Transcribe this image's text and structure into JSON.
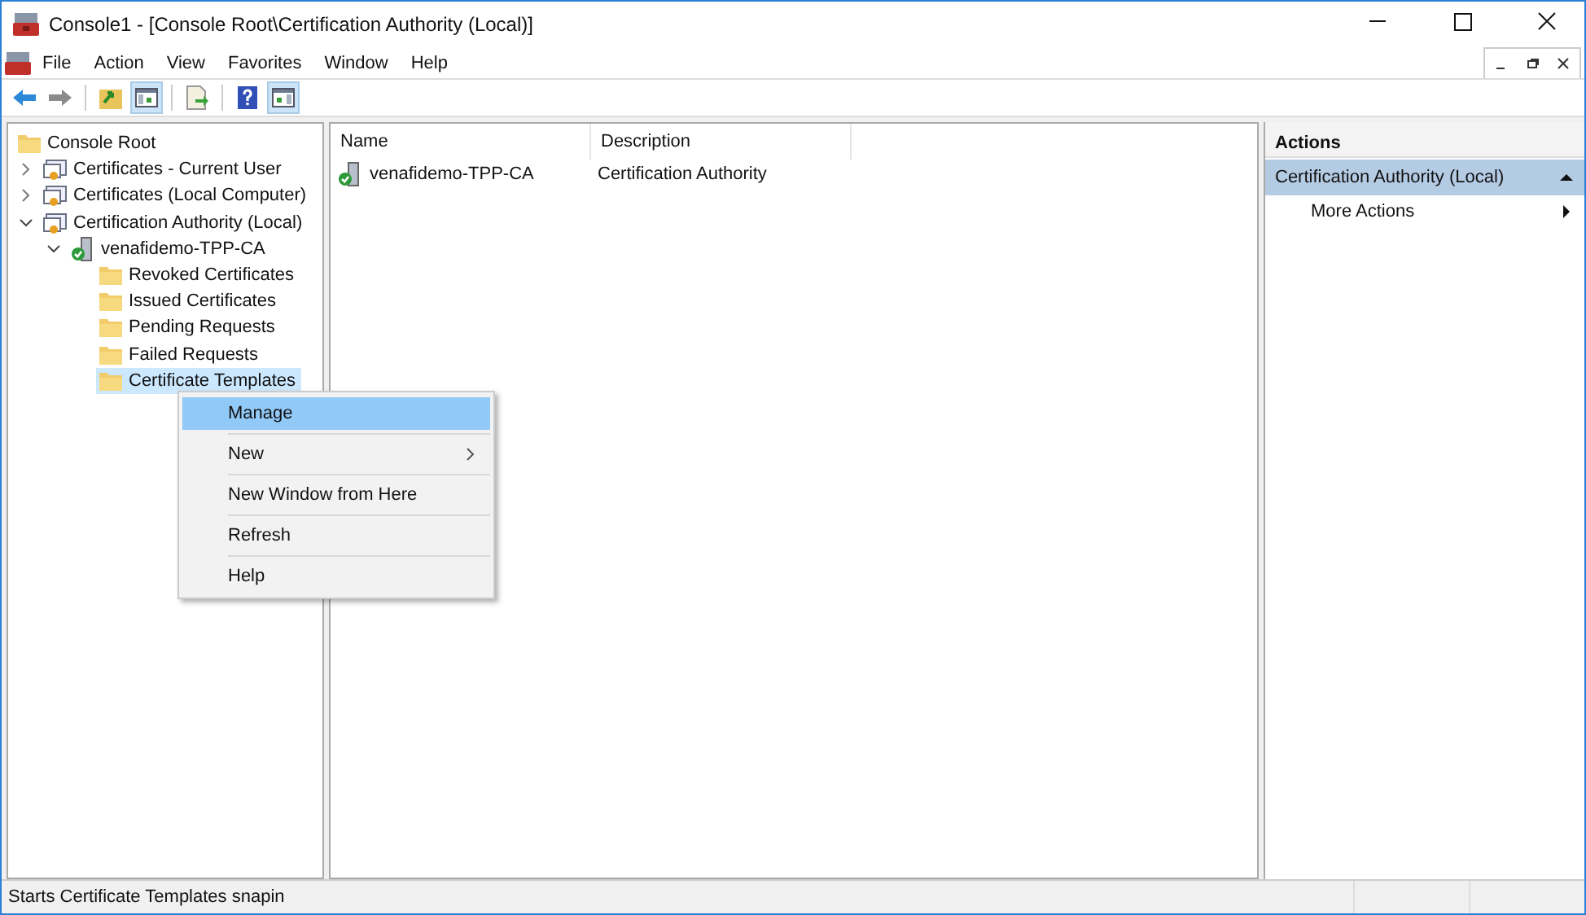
{
  "window": {
    "title": "Console1 - [Console Root\\Certification Authority (Local)]"
  },
  "menu": [
    "File",
    "Action",
    "View",
    "Favorites",
    "Window",
    "Help"
  ],
  "toolbar": [
    {
      "kind": "back",
      "pressed": false
    },
    {
      "kind": "forward",
      "pressed": false
    },
    {
      "kind": "up",
      "pressed": false
    },
    {
      "kind": "tree",
      "pressed": true
    },
    {
      "kind": "export",
      "pressed": false
    },
    {
      "kind": "help",
      "pressed": false
    },
    {
      "kind": "pane",
      "pressed": true
    }
  ],
  "tree": [
    {
      "label": "Console Root",
      "kind": "folder",
      "selected": false,
      "children": [
        {
          "label": "Certificates - Current User",
          "kind": "store",
          "expanded": false,
          "selected": false
        },
        {
          "label": "Certificates (Local Computer)",
          "kind": "store",
          "expanded": false,
          "selected": false
        },
        {
          "label": "Certification Authority (Local)",
          "kind": "store",
          "expanded": true,
          "selected": false,
          "children": [
            {
              "label": "venafidemo-TPP-CA",
              "kind": "server",
              "expanded": true,
              "selected": false,
              "children": [
                {
                  "label": "Revoked Certificates",
                  "kind": "folder",
                  "selected": false
                },
                {
                  "label": "Issued Certificates",
                  "kind": "folder",
                  "selected": false
                },
                {
                  "label": "Pending Requests",
                  "kind": "folder",
                  "selected": false
                },
                {
                  "label": "Failed Requests",
                  "kind": "folder",
                  "selected": false
                },
                {
                  "label": "Certificate Templates",
                  "kind": "folder",
                  "selected": true
                }
              ]
            }
          ]
        }
      ]
    }
  ],
  "list": {
    "columns": [
      "Name",
      "Description"
    ],
    "rows": [
      {
        "name": "venafidemo-TPP-CA",
        "description": "Certification Authority"
      }
    ]
  },
  "context_menu": [
    {
      "label": "Manage",
      "selected": true,
      "submenu": false
    },
    {
      "label": "New",
      "selected": false,
      "submenu": true
    },
    {
      "label": "New Window from Here",
      "selected": false,
      "submenu": false
    },
    {
      "label": "Refresh",
      "selected": false,
      "submenu": false
    },
    {
      "label": "Help",
      "selected": false,
      "submenu": false
    }
  ],
  "actions": {
    "title": "Actions",
    "section": "Certification Authority (Local)",
    "items": [
      {
        "label": "More Actions",
        "submenu": true
      }
    ]
  },
  "status_bar": "Starts Certificate Templates snapin"
}
